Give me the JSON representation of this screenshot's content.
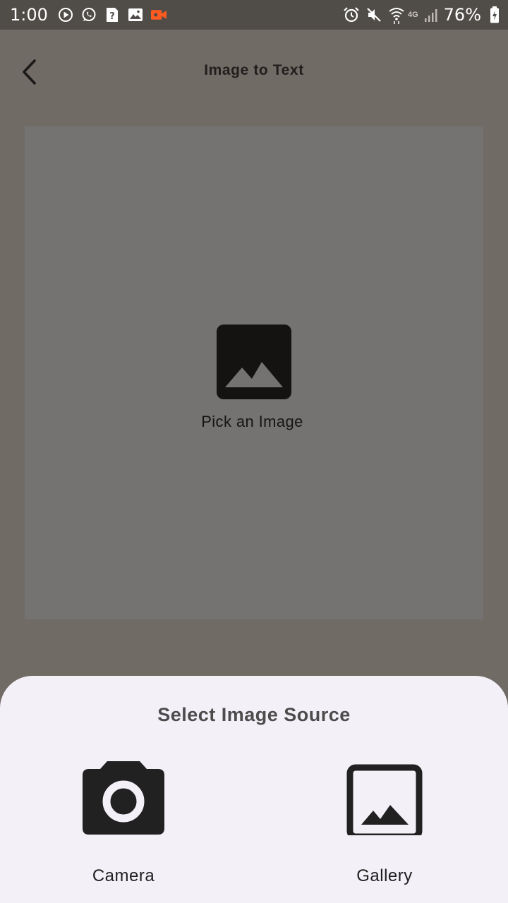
{
  "status_bar": {
    "time": "1:00",
    "battery_percent": "76%",
    "network_label": "4G",
    "left_icons": [
      "play-icon",
      "whatsapp-icon",
      "unknown-app-icon",
      "image-notification-icon",
      "video-recorder-icon"
    ],
    "right_icons": [
      "alarm-icon",
      "mute-icon",
      "wifi-icon",
      "signal-icon",
      "battery-charging-icon"
    ],
    "colors": {
      "background": "#504c48",
      "recorder_accent": "#ff5a1f"
    }
  },
  "app_bar": {
    "title": "Image to Text",
    "back_icon": "chevron-left-icon"
  },
  "picker": {
    "icon": "image-icon",
    "label": "Pick an Image"
  },
  "bottom_sheet": {
    "title": "Select Image Source",
    "options": [
      {
        "label": "Camera",
        "icon": "camera-icon"
      },
      {
        "label": "Gallery",
        "icon": "gallery-icon"
      }
    ]
  },
  "colors": {
    "scrim": "#716b66",
    "picker_area": "#747371",
    "sheet_background": "#f4f0f8"
  }
}
